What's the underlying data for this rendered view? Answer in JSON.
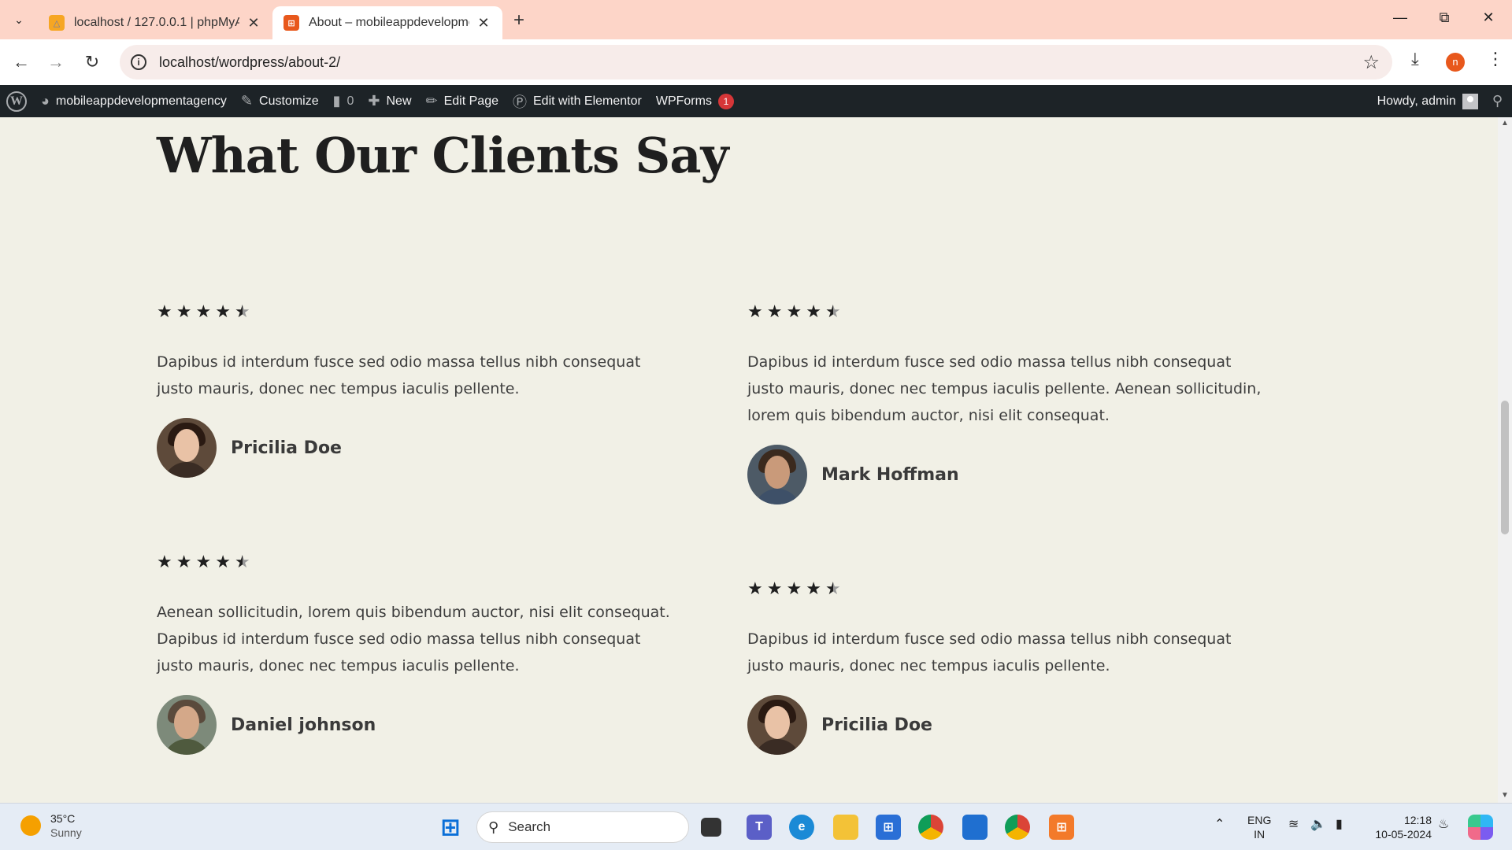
{
  "browser": {
    "tabs": [
      {
        "title": "localhost / 127.0.0.1 | phpMyAd",
        "favicon": "phpmyadmin-icon",
        "active": false
      },
      {
        "title": "About – mobileappdevelopmen",
        "favicon": "elementor-site-icon",
        "active": true
      }
    ],
    "url": "localhost/wordpress/about-2/",
    "profile_initial": "n"
  },
  "adminbar": {
    "site_name": "mobileappdevelopmentagency",
    "customize": "Customize",
    "comments_count": "0",
    "new": "New",
    "edit_page": "Edit Page",
    "edit_elementor": "Edit with Elementor",
    "wpforms": "WPForms",
    "wpforms_badge": "1",
    "howdy": "Howdy, admin"
  },
  "section": {
    "title": "What Our Clients Say"
  },
  "testimonials": [
    {
      "rating": 4.5,
      "quote": "Dapibus id interdum fusce sed odio massa tellus nibh consequat justo mauris, donec nec tempus iaculis pellente.",
      "name": "Pricilia Doe"
    },
    {
      "rating": 4.5,
      "quote": "Dapibus id interdum fusce sed odio massa tellus nibh consequat justo mauris, donec nec tempus iaculis pellente. Aenean sollicitudin, lorem quis bibendum auctor, nisi elit consequat.",
      "name": "Mark Hoffman"
    },
    {
      "rating": 4.5,
      "quote": "Aenean sollicitudin, lorem quis bibendum auctor, nisi elit consequat. Dapibus id interdum fusce sed odio massa tellus nibh consequat justo mauris, donec nec tempus iaculis pellente.",
      "name": "Daniel johnson"
    },
    {
      "rating": 4.5,
      "quote": "Dapibus id interdum fusce sed odio massa tellus nibh consequat justo mauris, donec nec tempus iaculis pellente.",
      "name": "Pricilia Doe"
    }
  ],
  "taskbar": {
    "temperature": "35°C",
    "condition": "Sunny",
    "search_placeholder": "Search",
    "lang_line1": "ENG",
    "lang_line2": "IN",
    "time": "12:18",
    "date": "10-05-2024"
  }
}
